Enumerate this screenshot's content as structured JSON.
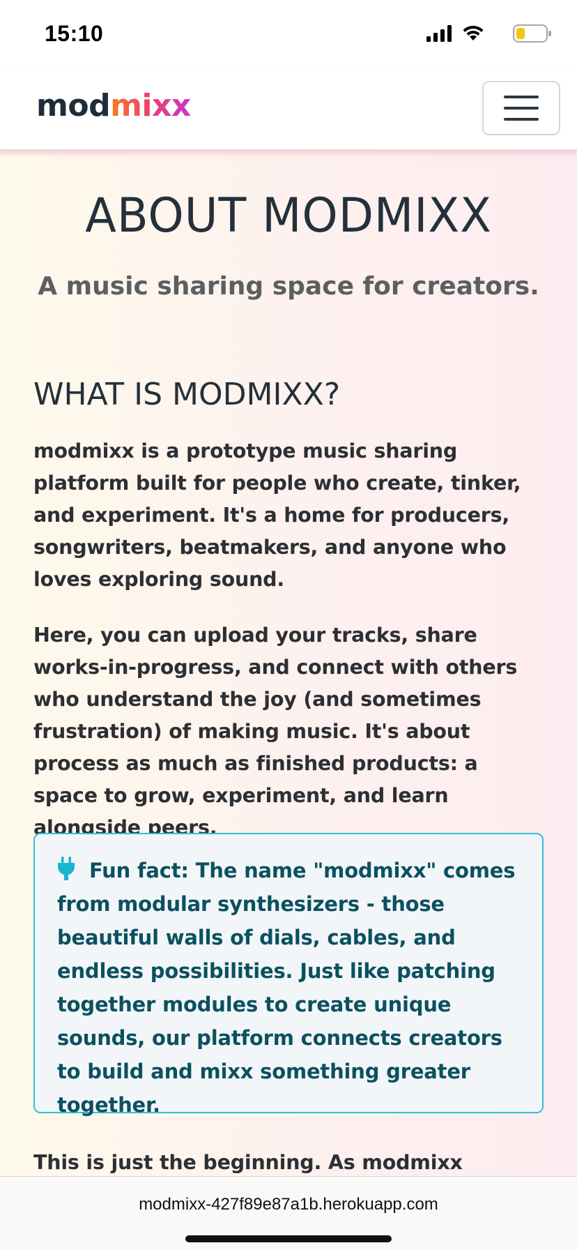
{
  "status_bar": {
    "time": "15:10",
    "icons": [
      "cellular-signal-icon",
      "wifi-icon",
      "battery-icon"
    ],
    "battery_level": 0.3,
    "battery_color": "#f6c412"
  },
  "navbar": {
    "brand_part1": "mod",
    "brand_part2": "mixx",
    "menu_icon": "hamburger-menu-icon"
  },
  "main": {
    "title": "ABOUT MODMIXX",
    "subtitle": "A music sharing space for creators.",
    "section_heading": "WHAT IS MODMIXX?",
    "paragraph_1": "modmixx is a prototype music sharing platform built for people who create, tinker, and experiment. It's a home for producers, songwriters, beatmakers, and anyone who loves exploring sound.",
    "paragraph_2": "Here, you can upload your tracks, share works-in-progress, and connect with others who understand the joy (and sometimes frustration) of making music. It's about process as much as finished products: a space to grow, experiment, and learn alongside peers.",
    "fun_fact": {
      "icon": "plug-icon",
      "text": "Fun fact: The name \"modmixx\" comes from modular synthesizers - those beautiful walls of dials, cables, and endless possibilities. Just like patching together modules to create unique sounds, our platform connects creators to build and mixx something greater together."
    },
    "paragraph_3": "This is just the beginning. As modmixx evolves,"
  },
  "browser": {
    "url": "modmixx-427f89e87a1b.herokuapp.com"
  },
  "colors": {
    "brand_dark": "#1f2d3a",
    "brand_gradient": [
      "#f57c20",
      "#ec3f6b",
      "#c03ad0"
    ],
    "funfact_border": "#2ec0d6",
    "funfact_text": "#0b5160"
  }
}
